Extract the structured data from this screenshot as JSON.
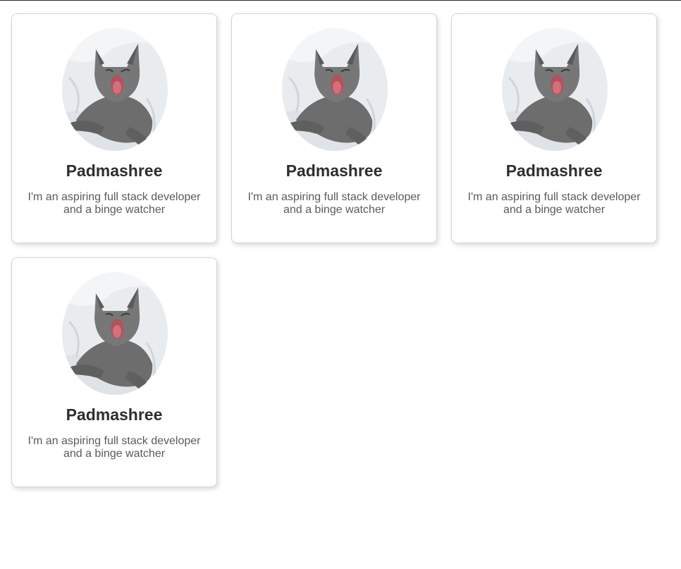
{
  "cards": [
    {
      "name": "Padmashree",
      "bio": "I'm an aspiring full stack developer and a binge watcher",
      "photo_icon": "yawning-gray-cat-photo"
    },
    {
      "name": "Padmashree",
      "bio": "I'm an aspiring full stack developer and a binge watcher",
      "photo_icon": "yawning-gray-cat-photo"
    },
    {
      "name": "Padmashree",
      "bio": "I'm an aspiring full stack developer and a binge watcher",
      "photo_icon": "yawning-gray-cat-photo"
    },
    {
      "name": "Padmashree",
      "bio": "I'm an aspiring full stack developer and a binge watcher",
      "photo_icon": "yawning-gray-cat-photo"
    }
  ],
  "colors": {
    "card_border": "#d4d4d4",
    "name_text": "#2e2e2e",
    "bio_text": "#5a5a5a",
    "cat_fur": "#6f6f6f",
    "bedsheet": "#e9ecef",
    "mouth": "#d4707a"
  }
}
